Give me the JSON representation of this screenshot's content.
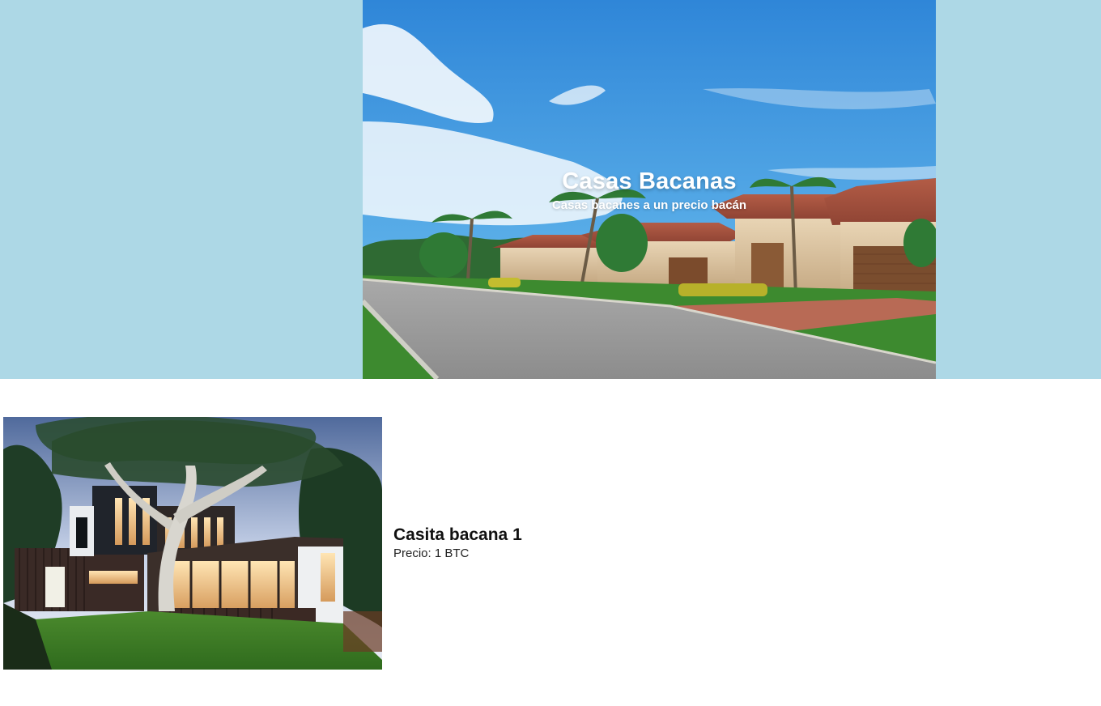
{
  "hero": {
    "title": "Casas Bacanas",
    "subtitle": "Casas bacanes a un precio bacán"
  },
  "listing": {
    "title": "Casita bacana 1",
    "price": "Precio: 1 BTC"
  },
  "colors": {
    "page_bg": "#ffffff",
    "hero_band": "#add8e6",
    "text_dark": "#111111",
    "sky": "#4b9fe0",
    "grass": "#3d7f2d"
  },
  "icons": {
    "hero": "street-photo",
    "listing": "house-photo"
  }
}
